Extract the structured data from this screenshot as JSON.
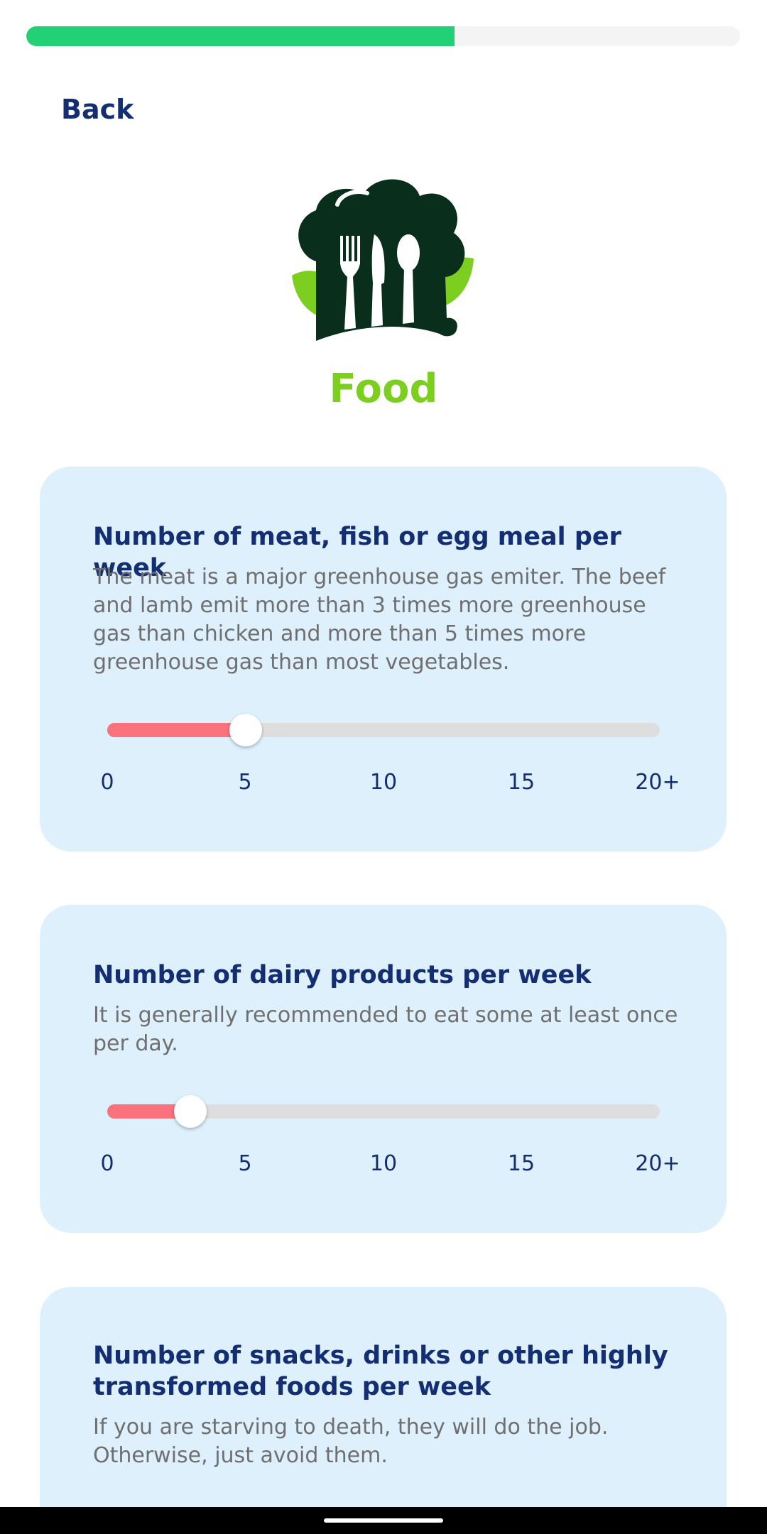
{
  "progress": {
    "value": 0.6
  },
  "nav": {
    "back_label": "Back"
  },
  "section": {
    "title": "Food",
    "icon": "chef-hat-cutlery-icon"
  },
  "questions": [
    {
      "title": "Number of meat, fish or egg meal per week",
      "description": "The meat is a major greenhouse gas emiter. The beef and lamb emit more than 3 times more greenhouse gas than chicken and more than 5 times more greenhouse gas than most vegetables.",
      "slider": {
        "value": 5,
        "min": 0,
        "max": 20,
        "ticks": [
          "0",
          "5",
          "10",
          "15",
          "20+"
        ]
      }
    },
    {
      "title": "Number of dairy products per week",
      "description": "It is generally recommended to eat some at least once per day.",
      "slider": {
        "value": 3,
        "min": 0,
        "max": 20,
        "ticks": [
          "0",
          "5",
          "10",
          "15",
          "20+"
        ]
      }
    },
    {
      "title": "Number of snacks, drinks or other highly transformed foods per week",
      "description": "If you are starving to death, they will do the job. Otherwise, just avoid them."
    }
  ],
  "colors": {
    "progress": "#22d176",
    "accent": "#7ccf1e",
    "text_dark": "#142e74",
    "card_bg": "#ddf0fc",
    "slider_fill": "#f9727d"
  }
}
